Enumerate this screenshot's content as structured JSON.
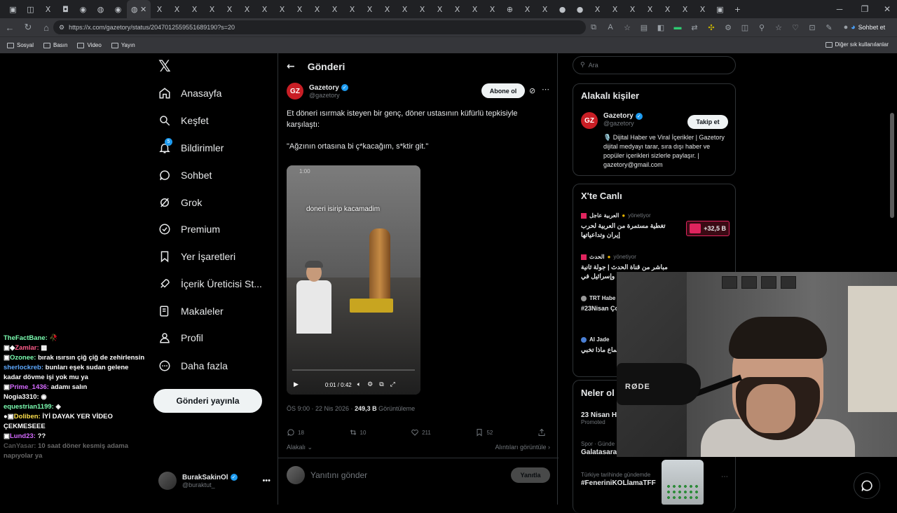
{
  "browser": {
    "url": "https://x.com/gazetory/status/2047012559551689190?s=20",
    "bookmarks": [
      "Sosyal",
      "Basın",
      "Video",
      "Yayın"
    ],
    "bookmarks_right": "Diğer sık kullanılanlar",
    "sohbet_label": "Sohbet et"
  },
  "nav": {
    "items": [
      {
        "label": "Anasayfa",
        "icon": "home-icon"
      },
      {
        "label": "Keşfet",
        "icon": "search-icon"
      },
      {
        "label": "Bildirimler",
        "icon": "bell-icon"
      },
      {
        "label": "Sohbet",
        "icon": "chat-icon"
      },
      {
        "label": "Grok",
        "icon": "grok-icon"
      },
      {
        "label": "Premium",
        "icon": "premium-icon"
      },
      {
        "label": "Yer İşaretleri",
        "icon": "bookmark-icon"
      },
      {
        "label": "İçerik Üreticisi St...",
        "icon": "rocket-icon"
      },
      {
        "label": "Makaleler",
        "icon": "article-icon"
      },
      {
        "label": "Profil",
        "icon": "person-icon"
      },
      {
        "label": "Daha fazla",
        "icon": "more-circle-icon"
      }
    ],
    "notification_count": "5",
    "post_button": "Gönderi yayınla",
    "profile": {
      "name": "BurakSakinOl",
      "handle": "@buraktut_"
    }
  },
  "main": {
    "header_title": "Gönderi",
    "author": {
      "name": "Gazetory",
      "handle": "@gazetory",
      "logo_text": "GZ"
    },
    "subscribe_button": "Abone ol",
    "text": "Et döneri ısırmak isteyen bir genç, döner ustasının küfürlü tepkisiyle karşılaştı:",
    "quote": "\"Ağzının ortasına bi ç*kacağım, s*ktir git.\"",
    "video": {
      "caption": "doneri isirip kacamadim",
      "time_top": "1:00",
      "time": "0:01 / 0:42"
    },
    "meta_time": "ÖS 9:00 · 22 Nis 2026 · ",
    "meta_views": "249,3 B",
    "meta_views_label": " Görüntüleme",
    "stats": {
      "replies": "18",
      "reposts": "10",
      "likes": "211",
      "bookmarks": "52"
    },
    "related_left": "Alakalı",
    "related_right": "Alıntıları görüntüle",
    "reply_placeholder": "Yanıtını gönder",
    "reply_button": "Yanıtla"
  },
  "right": {
    "search_placeholder": "Ara",
    "related_title": "Alakalı kişiler",
    "related_person": {
      "name": "Gazetory",
      "handle": "@gazetory",
      "follow": "Takip et",
      "bio": "🎙️ Dijital Haber ve Viral İçerikler | Gazetory dijital medyayı tarar, sıra dışı haber ve popüler içerikleri sizlerle paylaşır. | gazetory@gmail.com"
    },
    "live_title": "X'te Canlı",
    "live": [
      {
        "source": "العربية عاجل",
        "status": "yönetiyor",
        "title": "تغطية مستمرة من العربية لحرب إيران وتداعياتها",
        "count": "+32,5 B"
      },
      {
        "source": "الحدث",
        "status": "yönetiyor",
        "title": "مباشر من قناة الحدث | جولة ثانية وإسرائيل في",
        "count": ""
      },
      {
        "source": "TRT Habe",
        "status": "",
        "title": "#23Nisan Çocuk Bay",
        "count": ""
      },
      {
        "source": "Al Jade",
        "status": "",
        "title": "...مين واجتماع ماذا تخبي",
        "count": ""
      }
    ],
    "trends_title": "Neler ol",
    "trends": [
      {
        "line": "",
        "title": "23 Nisan H",
        "sub": "Promoted"
      },
      {
        "line": "Spor · Günde",
        "title": "Galatasara",
        "sub": ""
      },
      {
        "line": "Türkiye tarihinde gündemde",
        "title": "#FeneriniKOLlamaTFF",
        "sub": ""
      }
    ]
  },
  "chat": [
    {
      "user": "TheFactBane:",
      "msg": "",
      "color": "#7cffb2"
    },
    {
      "user": "Zamlar:",
      "msg": "",
      "color": "#ff5c8a"
    },
    {
      "user": "Ozonee:",
      "msg": "bırak ısırsın çiğ çiğ de zehirlensin",
      "color": "#7cffb2"
    },
    {
      "user": "sherlockreb:",
      "msg": "bunları eşek sudan gelene kadar dövme işi yok mu ya",
      "color": "#5da9ff"
    },
    {
      "user": "Prime_1436:",
      "msg": "adamı salın",
      "color": "#d56aff"
    },
    {
      "user": "Nogia3310:",
      "msg": "",
      "color": "#ffffff"
    },
    {
      "user": "equestrian1199:",
      "msg": "",
      "color": "#7cffb2"
    },
    {
      "user": "Doliben:",
      "msg": "İYİ DAYAK YER VİDEO ÇEKMESEEE",
      "color": "#ffe14d"
    },
    {
      "user": "Lund23:",
      "msg": "??",
      "color": "#d56aff"
    },
    {
      "user": "CanYasar:",
      "msg": "10 saat döner kesmiş adama napıyolar ya",
      "color": "#8a8a8a"
    }
  ],
  "webcam": {
    "mic_brand": "RØDE"
  },
  "colors": {
    "accent": "#1d9bf0",
    "live_red": "#e0245e",
    "brand_gz": "#c81e25"
  }
}
